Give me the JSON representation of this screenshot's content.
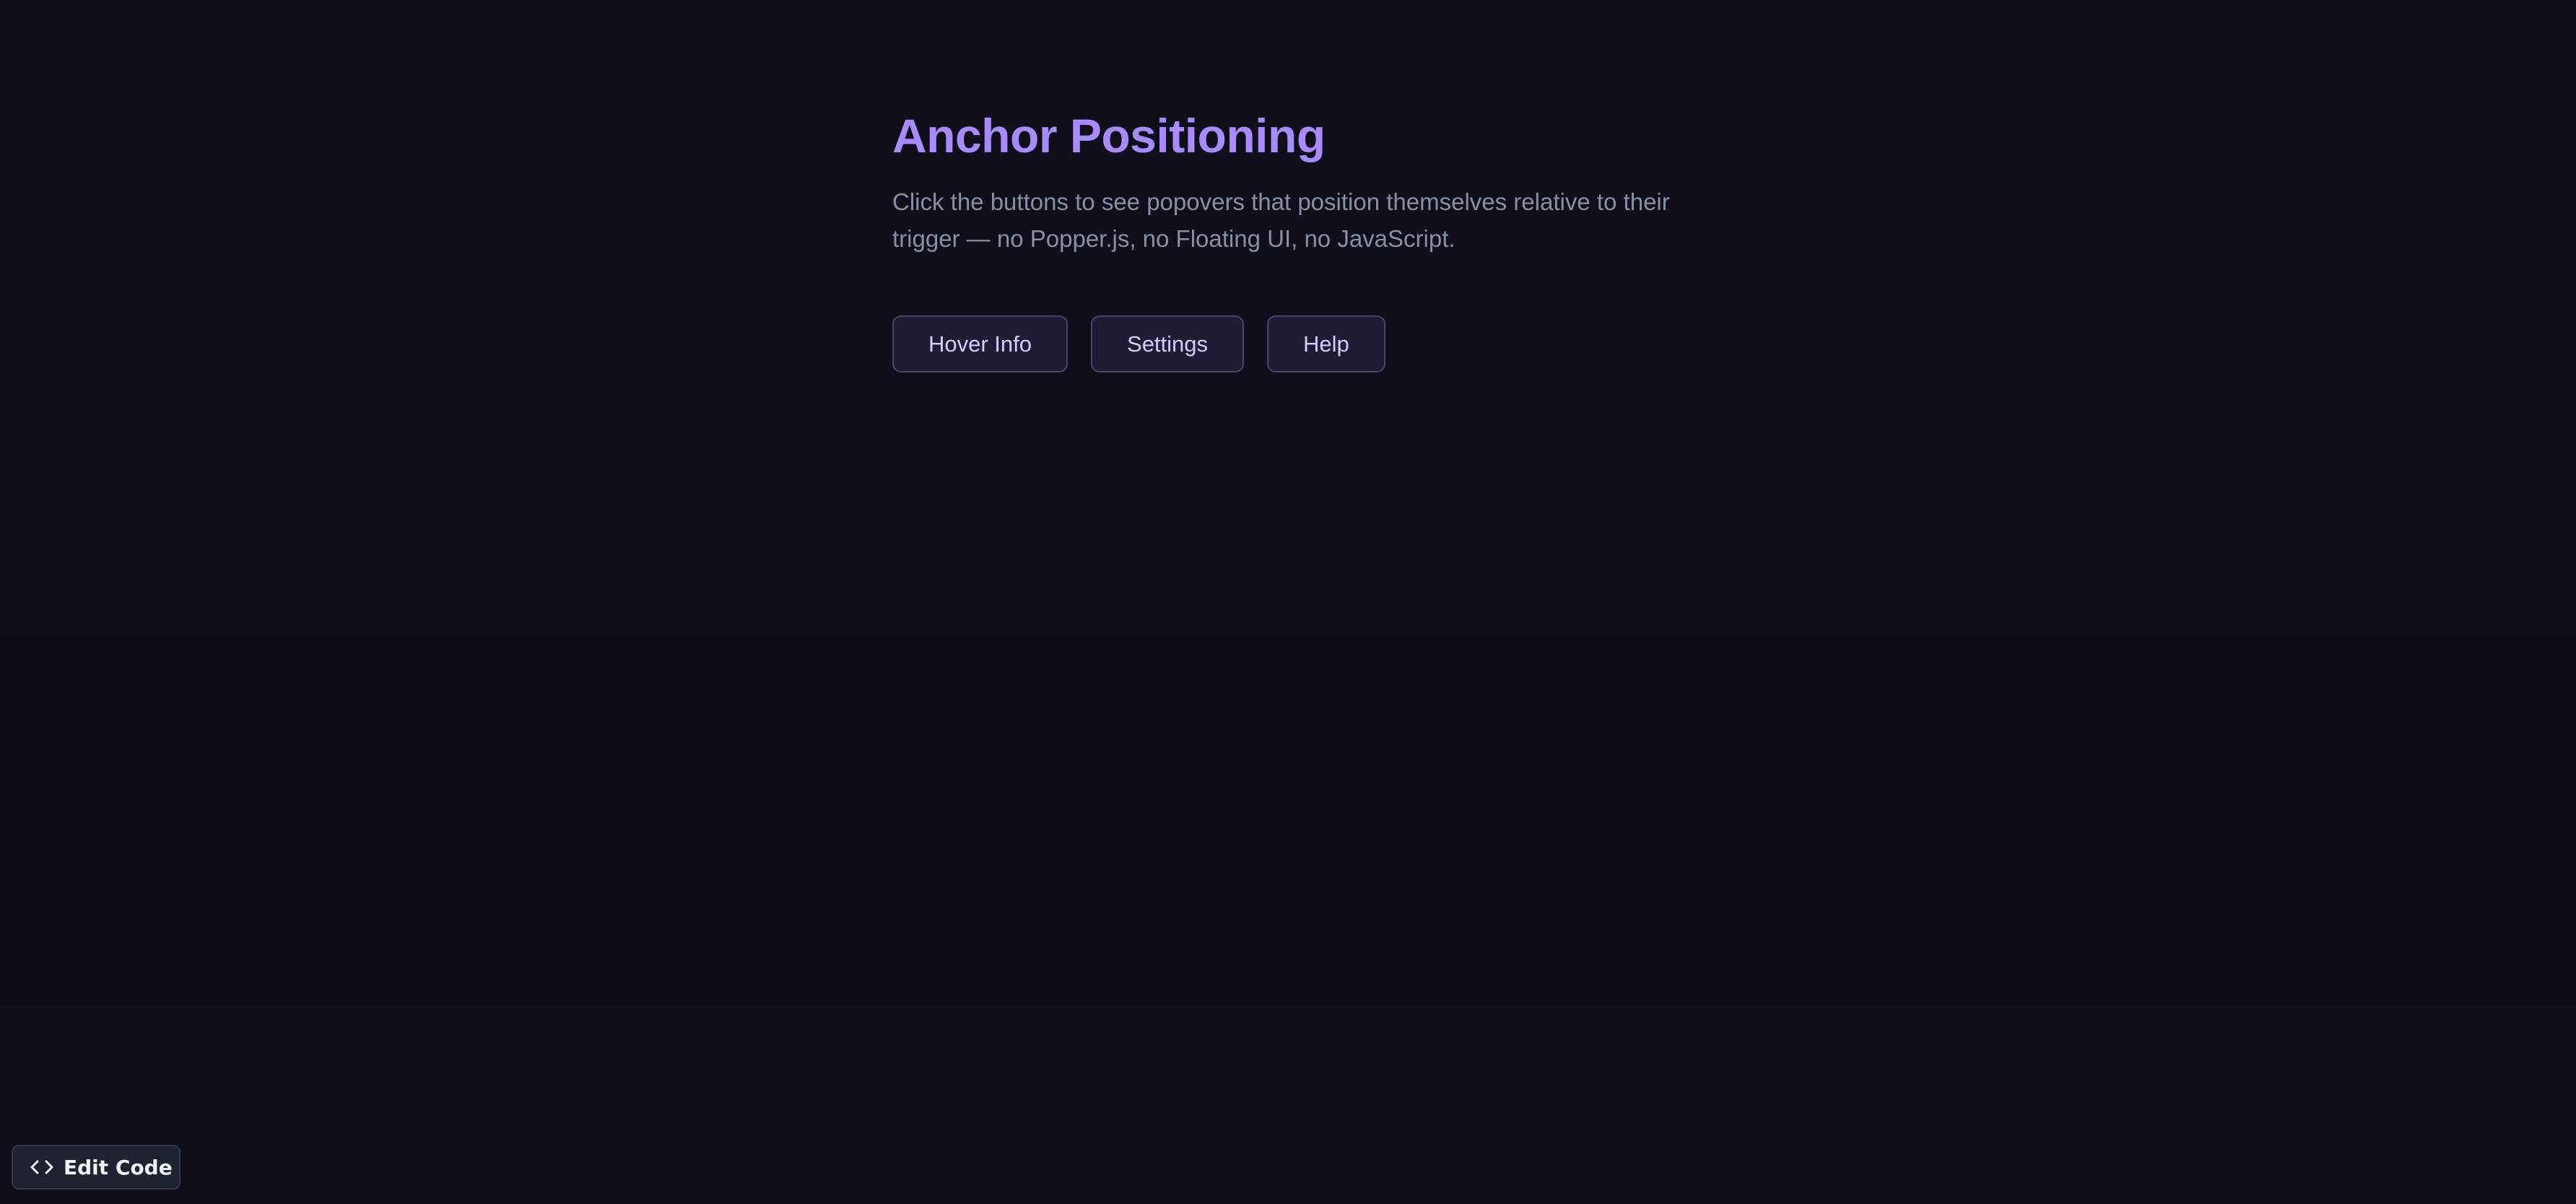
{
  "page": {
    "title": "Anchor Positioning",
    "description": "Click the buttons to see popovers that position themselves relative to their trigger — no Popper.js, no Floating UI, no JavaScript."
  },
  "buttons": [
    {
      "label": "Hover Info"
    },
    {
      "label": "Settings"
    },
    {
      "label": "Help"
    }
  ],
  "edit_code": {
    "label": "Edit Code",
    "icon": "code-icon"
  },
  "colors": {
    "background": "#0e0f1b",
    "title_accent": "#a78bfa",
    "description_text": "#8b8fa3",
    "button_background": "#1f1c33",
    "button_border": "#4b4470",
    "button_text": "#d7ccff"
  }
}
